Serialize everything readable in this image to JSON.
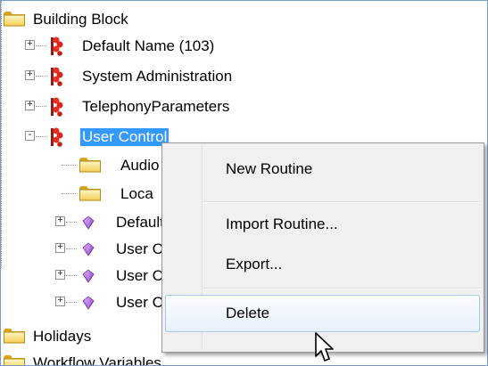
{
  "tree": {
    "root": {
      "label": "Building Block"
    },
    "building_blocks": [
      {
        "label": "Default Name (103)",
        "expander": "+"
      },
      {
        "label": "System Administration",
        "expander": "+"
      },
      {
        "label": "TelephonyParameters",
        "expander": "+"
      },
      {
        "label": "User Control",
        "expander": "-",
        "selected": true
      }
    ],
    "user_control_children": {
      "folders": [
        {
          "label": "Audio"
        },
        {
          "label": "Loca"
        }
      ],
      "routines": [
        {
          "label": "Default",
          "expander": "+"
        },
        {
          "label": "User C",
          "expander": "+"
        },
        {
          "label": "User C",
          "expander": "+"
        },
        {
          "label": "User C",
          "expander": "+"
        }
      ]
    },
    "roots_after": [
      {
        "label": "Holidays"
      },
      {
        "label": "Workflow Variables"
      }
    ]
  },
  "context_menu": {
    "new_routine": "New Routine",
    "import_routine": "Import Routine...",
    "export": "Export...",
    "delete": "Delete",
    "highlighted": "Delete"
  },
  "colors": {
    "selection": "#3399ff",
    "folder": "#ffe58f",
    "building_block_icon": "#d9261c",
    "routine_icon": "#9b59d0",
    "menu_background": "#f0f0f0",
    "menu_highlight_border": "#a8c8f0"
  },
  "icons": {
    "folder": "folder-icon",
    "building_block": "building-block-icon",
    "routine": "routine-gem-icon",
    "expand": "expand-plus-icon",
    "collapse": "collapse-minus-icon",
    "cursor": "mouse-cursor-icon"
  }
}
